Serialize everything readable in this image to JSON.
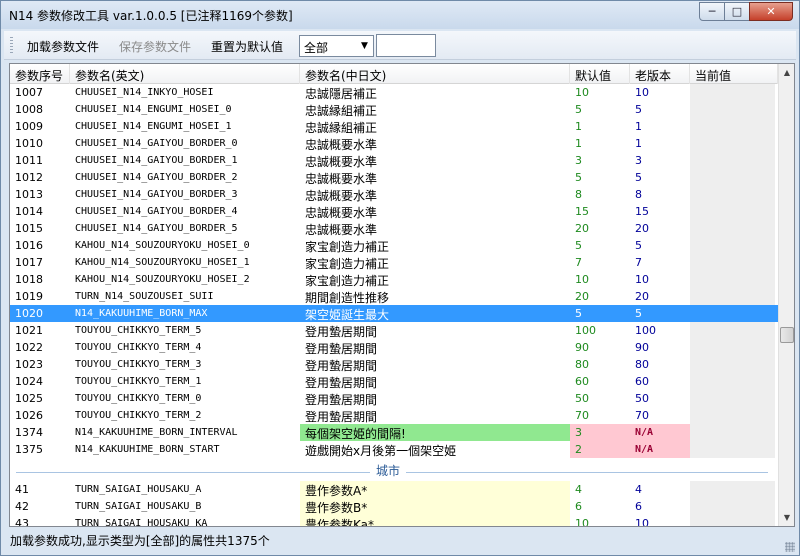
{
  "window": {
    "title": "N14 参数修改工具 var.1.0.0.5 [已注释1169个参数]",
    "buttons": {
      "minimize": "─",
      "maximize": "□",
      "close": "✕"
    }
  },
  "toolbar": {
    "load": "加载参数文件",
    "save": "保存参数文件",
    "reset": "重置为默认值",
    "filter_selected": "全部",
    "filter_text": ""
  },
  "columns": [
    "参数序号",
    "参数名(英文)",
    "参数名(中日文)",
    "默认值",
    "老版本",
    "当前值"
  ],
  "rows": [
    {
      "id": "1007",
      "en": "CHUUSEI_N14_INKYO_HOSEI",
      "cn": "忠誠隱居補正",
      "def": "10",
      "old": "10",
      "cur": "",
      "style": ""
    },
    {
      "id": "1008",
      "en": "CHUUSEI_N14_ENGUMI_HOSEI_0",
      "cn": "忠誠縁組補正",
      "def": "5",
      "old": "5",
      "cur": "",
      "style": ""
    },
    {
      "id": "1009",
      "en": "CHUUSEI_N14_ENGUMI_HOSEI_1",
      "cn": "忠誠縁組補正",
      "def": "1",
      "old": "1",
      "cur": "",
      "style": ""
    },
    {
      "id": "1010",
      "en": "CHUUSEI_N14_GAIYOU_BORDER_0",
      "cn": "忠誠概要水準",
      "def": "1",
      "old": "1",
      "cur": "",
      "style": ""
    },
    {
      "id": "1011",
      "en": "CHUUSEI_N14_GAIYOU_BORDER_1",
      "cn": "忠誠概要水準",
      "def": "3",
      "old": "3",
      "cur": "",
      "style": ""
    },
    {
      "id": "1012",
      "en": "CHUUSEI_N14_GAIYOU_BORDER_2",
      "cn": "忠誠概要水準",
      "def": "5",
      "old": "5",
      "cur": "",
      "style": ""
    },
    {
      "id": "1013",
      "en": "CHUUSEI_N14_GAIYOU_BORDER_3",
      "cn": "忠誠概要水準",
      "def": "8",
      "old": "8",
      "cur": "",
      "style": ""
    },
    {
      "id": "1014",
      "en": "CHUUSEI_N14_GAIYOU_BORDER_4",
      "cn": "忠誠概要水準",
      "def": "15",
      "old": "15",
      "cur": "",
      "style": ""
    },
    {
      "id": "1015",
      "en": "CHUUSEI_N14_GAIYOU_BORDER_5",
      "cn": "忠誠概要水準",
      "def": "20",
      "old": "20",
      "cur": "",
      "style": ""
    },
    {
      "id": "1016",
      "en": "KAHOU_N14_SOUZOURYOKU_HOSEI_0",
      "cn": "家宝創造力補正",
      "def": "5",
      "old": "5",
      "cur": "",
      "style": ""
    },
    {
      "id": "1017",
      "en": "KAHOU_N14_SOUZOURYOKU_HOSEI_1",
      "cn": "家宝創造力補正",
      "def": "7",
      "old": "7",
      "cur": "",
      "style": ""
    },
    {
      "id": "1018",
      "en": "KAHOU_N14_SOUZOURYOKU_HOSEI_2",
      "cn": "家宝創造力補正",
      "def": "10",
      "old": "10",
      "cur": "",
      "style": ""
    },
    {
      "id": "1019",
      "en": "TURN_N14_SOUZOUSEI_SUII",
      "cn": "期間創造性推移",
      "def": "20",
      "old": "20",
      "cur": "",
      "style": ""
    },
    {
      "id": "1020",
      "en": "N14_KAKUUHIME_BORN_MAX",
      "cn": "架空姫誕生最大",
      "def": "5",
      "old": "5",
      "cur": "",
      "style": "selected"
    },
    {
      "id": "1021",
      "en": "TOUYOU_CHIKKYO_TERM_5",
      "cn": "登用蟄居期間",
      "def": "100",
      "old": "100",
      "cur": "",
      "style": ""
    },
    {
      "id": "1022",
      "en": "TOUYOU_CHIKKYO_TERM_4",
      "cn": "登用蟄居期間",
      "def": "90",
      "old": "90",
      "cur": "",
      "style": ""
    },
    {
      "id": "1023",
      "en": "TOUYOU_CHIKKYO_TERM_3",
      "cn": "登用蟄居期間",
      "def": "80",
      "old": "80",
      "cur": "",
      "style": ""
    },
    {
      "id": "1024",
      "en": "TOUYOU_CHIKKYO_TERM_1",
      "cn": "登用蟄居期間",
      "def": "60",
      "old": "60",
      "cur": "",
      "style": ""
    },
    {
      "id": "1025",
      "en": "TOUYOU_CHIKKYO_TERM_0",
      "cn": "登用蟄居期間",
      "def": "50",
      "old": "50",
      "cur": "",
      "style": ""
    },
    {
      "id": "1026",
      "en": "TOUYOU_CHIKKYO_TERM_2",
      "cn": "登用蟄居期間",
      "def": "70",
      "old": "70",
      "cur": "",
      "style": ""
    },
    {
      "id": "1374",
      "en": "N14_KAKUUHIME_BORN_INTERVAL",
      "cn": "每個架空姫的間隔!",
      "def": "3",
      "old": "N/A",
      "cur": "",
      "style": "new-green"
    },
    {
      "id": "1375",
      "en": "N14_KAKUUHIME_BORN_START",
      "cn": "遊戲開始x月後第一個架空姫",
      "def": "2",
      "old": "N/A",
      "cur": "",
      "style": "new"
    }
  ],
  "group_label": "城市",
  "rows2": [
    {
      "id": "41",
      "en": "TURN_SAIGAI_HOUSAKU_A",
      "cn": "豊作参数A*",
      "def": "4",
      "old": "4",
      "cur": "",
      "style": "yellow"
    },
    {
      "id": "42",
      "en": "TURN_SAIGAI_HOUSAKU_B",
      "cn": "豊作参数B*",
      "def": "6",
      "old": "6",
      "cur": "",
      "style": "yellow"
    },
    {
      "id": "43",
      "en": "TURN_SAIGAI_HOUSAKU_KA",
      "cn": "豊作参数Ka*",
      "def": "10",
      "old": "10",
      "cur": "",
      "style": "yellow"
    }
  ],
  "status": "加载参数成功,显示类型为[全部]的属性共1375个"
}
